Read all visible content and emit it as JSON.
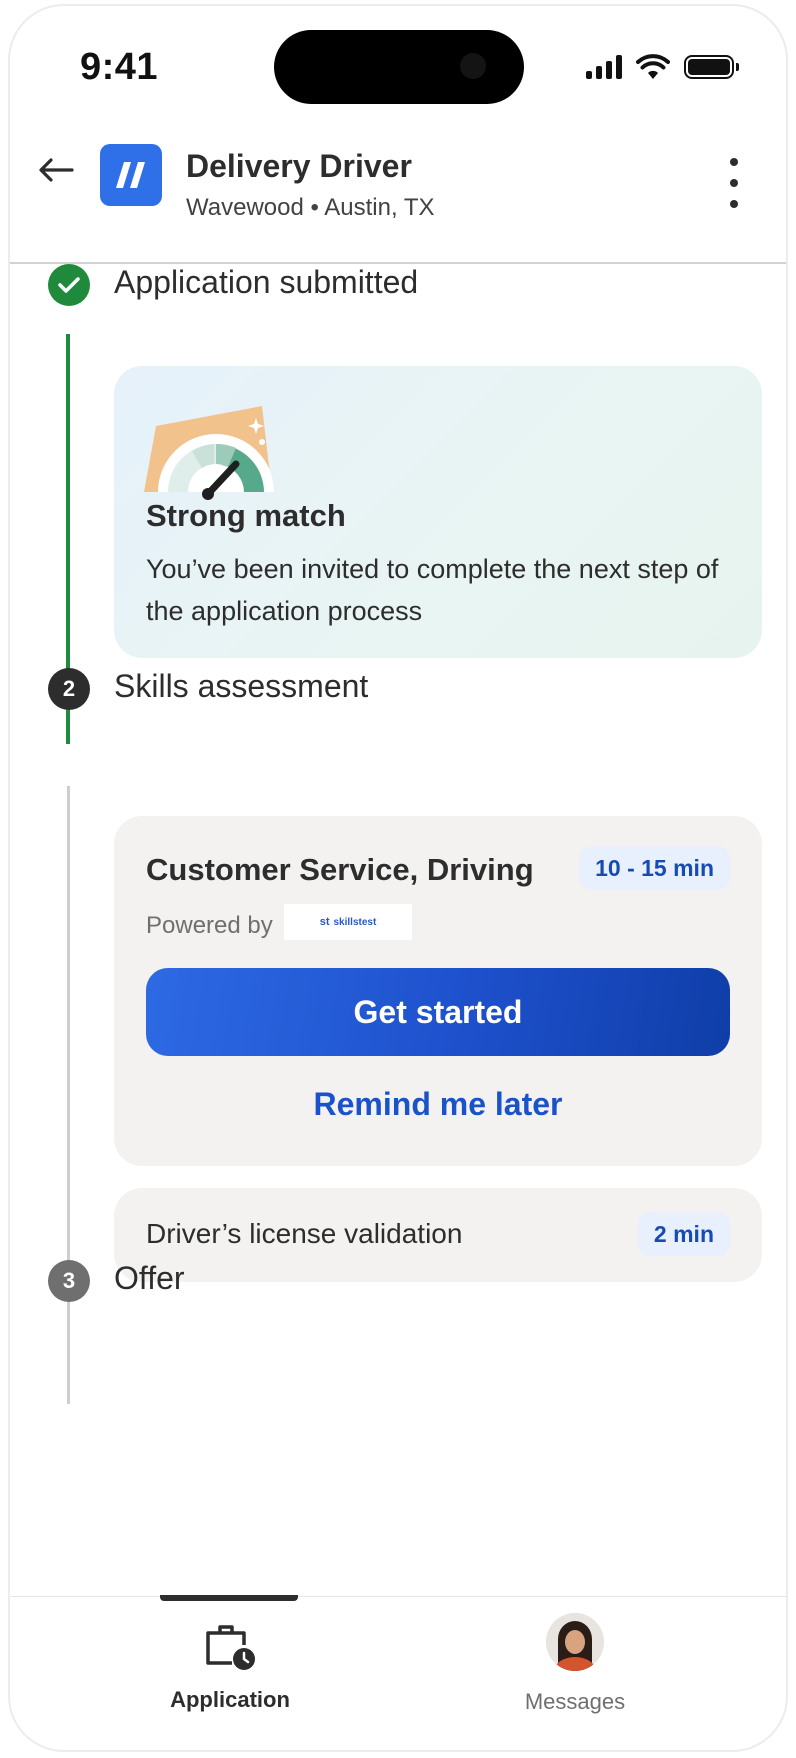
{
  "status_bar": {
    "time": "9:41"
  },
  "header": {
    "job_title": "Delivery Driver",
    "company": "Wavewood",
    "separator": "•",
    "location": "Austin, TX"
  },
  "timeline": {
    "steps": [
      {
        "number": "",
        "label": "Application submitted",
        "state": "complete"
      },
      {
        "number": "2",
        "label": "Skills assessment",
        "state": "current"
      },
      {
        "number": "3",
        "label": "Offer",
        "state": "upcoming"
      }
    ]
  },
  "match_card": {
    "title": "Strong match",
    "description": "You’ve been invited to complete the next step of the application process"
  },
  "skills_card": {
    "title": "Customer Service, Driving",
    "duration": "10 - 15 min",
    "powered_by": "Powered by",
    "provider_logo_text": "skillstest",
    "primary_button": "Get started",
    "secondary_button": "Remind me later"
  },
  "license_card": {
    "title": "Driver’s license validation",
    "duration": "2 min"
  },
  "bottom_nav": {
    "items": [
      {
        "label": "Application",
        "active": true
      },
      {
        "label": "Messages",
        "active": false
      }
    ]
  },
  "colors": {
    "primary_blue": "#1a53c9",
    "success_green": "#1f8a3c",
    "current_step": "#2d2d2d",
    "upcoming_step": "#6f6f6f"
  }
}
